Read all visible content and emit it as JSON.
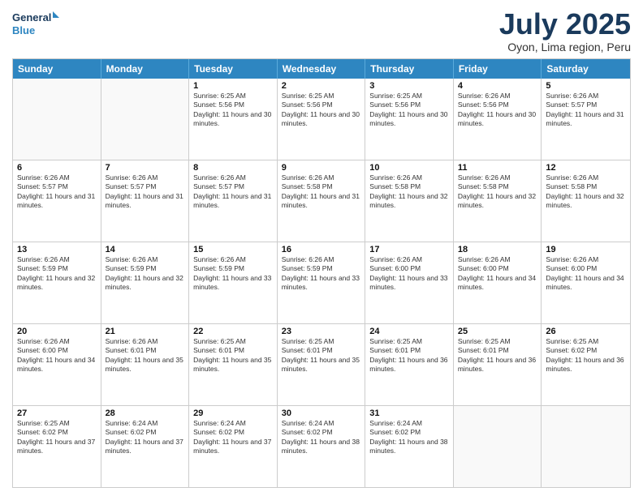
{
  "logo": {
    "line1": "General",
    "line2": "Blue"
  },
  "title": "July 2025",
  "location": "Oyon, Lima region, Peru",
  "days_header": [
    "Sunday",
    "Monday",
    "Tuesday",
    "Wednesday",
    "Thursday",
    "Friday",
    "Saturday"
  ],
  "weeks": [
    [
      {
        "day": "",
        "info": ""
      },
      {
        "day": "",
        "info": ""
      },
      {
        "day": "1",
        "info": "Sunrise: 6:25 AM\nSunset: 5:56 PM\nDaylight: 11 hours and 30 minutes."
      },
      {
        "day": "2",
        "info": "Sunrise: 6:25 AM\nSunset: 5:56 PM\nDaylight: 11 hours and 30 minutes."
      },
      {
        "day": "3",
        "info": "Sunrise: 6:25 AM\nSunset: 5:56 PM\nDaylight: 11 hours and 30 minutes."
      },
      {
        "day": "4",
        "info": "Sunrise: 6:26 AM\nSunset: 5:56 PM\nDaylight: 11 hours and 30 minutes."
      },
      {
        "day": "5",
        "info": "Sunrise: 6:26 AM\nSunset: 5:57 PM\nDaylight: 11 hours and 31 minutes."
      }
    ],
    [
      {
        "day": "6",
        "info": "Sunrise: 6:26 AM\nSunset: 5:57 PM\nDaylight: 11 hours and 31 minutes."
      },
      {
        "day": "7",
        "info": "Sunrise: 6:26 AM\nSunset: 5:57 PM\nDaylight: 11 hours and 31 minutes."
      },
      {
        "day": "8",
        "info": "Sunrise: 6:26 AM\nSunset: 5:57 PM\nDaylight: 11 hours and 31 minutes."
      },
      {
        "day": "9",
        "info": "Sunrise: 6:26 AM\nSunset: 5:58 PM\nDaylight: 11 hours and 31 minutes."
      },
      {
        "day": "10",
        "info": "Sunrise: 6:26 AM\nSunset: 5:58 PM\nDaylight: 11 hours and 32 minutes."
      },
      {
        "day": "11",
        "info": "Sunrise: 6:26 AM\nSunset: 5:58 PM\nDaylight: 11 hours and 32 minutes."
      },
      {
        "day": "12",
        "info": "Sunrise: 6:26 AM\nSunset: 5:58 PM\nDaylight: 11 hours and 32 minutes."
      }
    ],
    [
      {
        "day": "13",
        "info": "Sunrise: 6:26 AM\nSunset: 5:59 PM\nDaylight: 11 hours and 32 minutes."
      },
      {
        "day": "14",
        "info": "Sunrise: 6:26 AM\nSunset: 5:59 PM\nDaylight: 11 hours and 32 minutes."
      },
      {
        "day": "15",
        "info": "Sunrise: 6:26 AM\nSunset: 5:59 PM\nDaylight: 11 hours and 33 minutes."
      },
      {
        "day": "16",
        "info": "Sunrise: 6:26 AM\nSunset: 5:59 PM\nDaylight: 11 hours and 33 minutes."
      },
      {
        "day": "17",
        "info": "Sunrise: 6:26 AM\nSunset: 6:00 PM\nDaylight: 11 hours and 33 minutes."
      },
      {
        "day": "18",
        "info": "Sunrise: 6:26 AM\nSunset: 6:00 PM\nDaylight: 11 hours and 34 minutes."
      },
      {
        "day": "19",
        "info": "Sunrise: 6:26 AM\nSunset: 6:00 PM\nDaylight: 11 hours and 34 minutes."
      }
    ],
    [
      {
        "day": "20",
        "info": "Sunrise: 6:26 AM\nSunset: 6:00 PM\nDaylight: 11 hours and 34 minutes."
      },
      {
        "day": "21",
        "info": "Sunrise: 6:26 AM\nSunset: 6:01 PM\nDaylight: 11 hours and 35 minutes."
      },
      {
        "day": "22",
        "info": "Sunrise: 6:25 AM\nSunset: 6:01 PM\nDaylight: 11 hours and 35 minutes."
      },
      {
        "day": "23",
        "info": "Sunrise: 6:25 AM\nSunset: 6:01 PM\nDaylight: 11 hours and 35 minutes."
      },
      {
        "day": "24",
        "info": "Sunrise: 6:25 AM\nSunset: 6:01 PM\nDaylight: 11 hours and 36 minutes."
      },
      {
        "day": "25",
        "info": "Sunrise: 6:25 AM\nSunset: 6:01 PM\nDaylight: 11 hours and 36 minutes."
      },
      {
        "day": "26",
        "info": "Sunrise: 6:25 AM\nSunset: 6:02 PM\nDaylight: 11 hours and 36 minutes."
      }
    ],
    [
      {
        "day": "27",
        "info": "Sunrise: 6:25 AM\nSunset: 6:02 PM\nDaylight: 11 hours and 37 minutes."
      },
      {
        "day": "28",
        "info": "Sunrise: 6:24 AM\nSunset: 6:02 PM\nDaylight: 11 hours and 37 minutes."
      },
      {
        "day": "29",
        "info": "Sunrise: 6:24 AM\nSunset: 6:02 PM\nDaylight: 11 hours and 37 minutes."
      },
      {
        "day": "30",
        "info": "Sunrise: 6:24 AM\nSunset: 6:02 PM\nDaylight: 11 hours and 38 minutes."
      },
      {
        "day": "31",
        "info": "Sunrise: 6:24 AM\nSunset: 6:02 PM\nDaylight: 11 hours and 38 minutes."
      },
      {
        "day": "",
        "info": ""
      },
      {
        "day": "",
        "info": ""
      }
    ]
  ]
}
